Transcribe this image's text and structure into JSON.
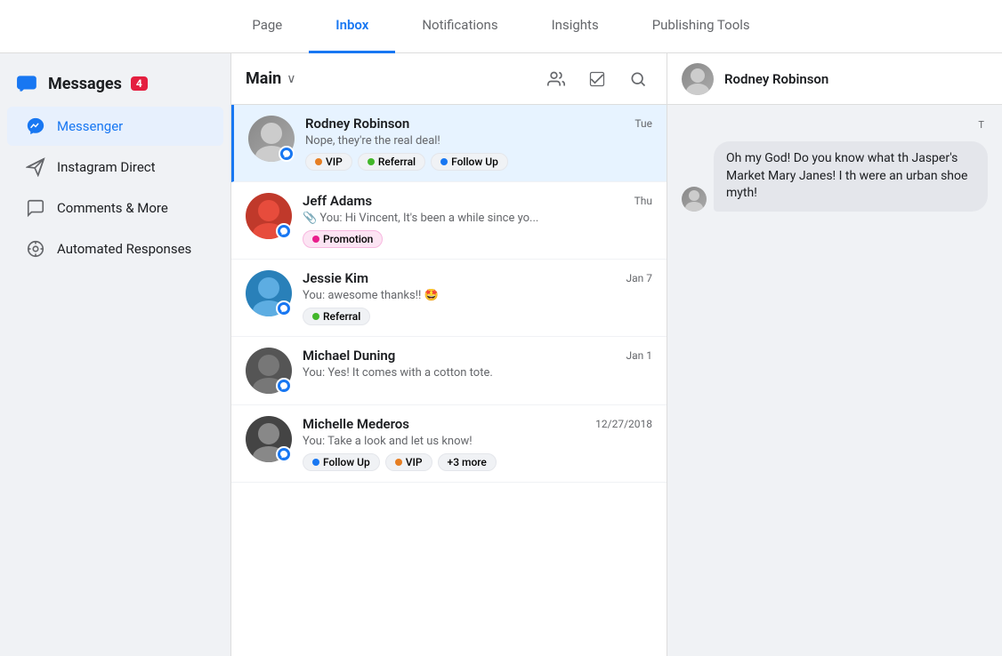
{
  "topNav": {
    "tabs": [
      {
        "id": "page",
        "label": "Page",
        "active": false
      },
      {
        "id": "inbox",
        "label": "Inbox",
        "active": true
      },
      {
        "id": "notifications",
        "label": "Notifications",
        "active": false
      },
      {
        "id": "insights",
        "label": "Insights",
        "active": false
      },
      {
        "id": "publishing",
        "label": "Publishing Tools",
        "active": false
      }
    ]
  },
  "sidebar": {
    "title": "Messages",
    "badge": "4",
    "items": [
      {
        "id": "messenger",
        "label": "Messenger",
        "icon": "💬",
        "active": true
      },
      {
        "id": "instagram",
        "label": "Instagram Direct",
        "icon": "✈",
        "active": false
      },
      {
        "id": "comments",
        "label": "Comments & More",
        "icon": "💬",
        "active": false
      },
      {
        "id": "automated",
        "label": "Automated Responses",
        "icon": "⊗",
        "active": false
      }
    ]
  },
  "inbox": {
    "title": "Main",
    "messages": [
      {
        "id": 1,
        "name": "Rodney Robinson",
        "preview": "Nope, they're the real deal!",
        "time": "Tue",
        "selected": true,
        "tags": [
          {
            "label": "VIP",
            "color": "#e67e22"
          },
          {
            "label": "Referral",
            "color": "#42b72a"
          },
          {
            "label": "Follow Up",
            "color": "#1877F2"
          }
        ],
        "avatarInitials": "RR",
        "avatarColor": "av-gray"
      },
      {
        "id": 2,
        "name": "Jeff Adams",
        "preview": "You: Hi Vincent, It's been a while since yo...",
        "previewIcon": "📎",
        "time": "Thu",
        "selected": false,
        "tags": [
          {
            "label": "Promotion",
            "color": "#e91e8c"
          }
        ],
        "avatarInitials": "JA",
        "avatarColor": "av-red"
      },
      {
        "id": 3,
        "name": "Jessie Kim",
        "preview": "You: awesome thanks!! 🤩",
        "time": "Jan 7",
        "selected": false,
        "tags": [
          {
            "label": "Referral",
            "color": "#42b72a"
          }
        ],
        "avatarInitials": "JK",
        "avatarColor": "av-blue"
      },
      {
        "id": 4,
        "name": "Michael Duning",
        "preview": "You: Yes! It comes with a cotton tote.",
        "time": "Jan 1",
        "selected": false,
        "tags": [],
        "avatarInitials": "MD",
        "avatarColor": "av-purple"
      },
      {
        "id": 5,
        "name": "Michelle Mederos",
        "preview": "You: Take a look and let us know!",
        "time": "12/27/2018",
        "selected": false,
        "tags": [
          {
            "label": "Follow Up",
            "color": "#1877F2"
          },
          {
            "label": "VIP",
            "color": "#e67e22"
          },
          {
            "label": "+3 more",
            "color": "#65676B"
          }
        ],
        "avatarInitials": "MM",
        "avatarColor": "av-gray"
      }
    ]
  },
  "chat": {
    "contactName": "Rodney Robinson",
    "messages": [
      {
        "id": 1,
        "type": "incoming",
        "text": "Oh my God! Do you know what th Jasper's Market Mary Janes! I th were an urban shoe myth!",
        "time": "T"
      }
    ]
  }
}
